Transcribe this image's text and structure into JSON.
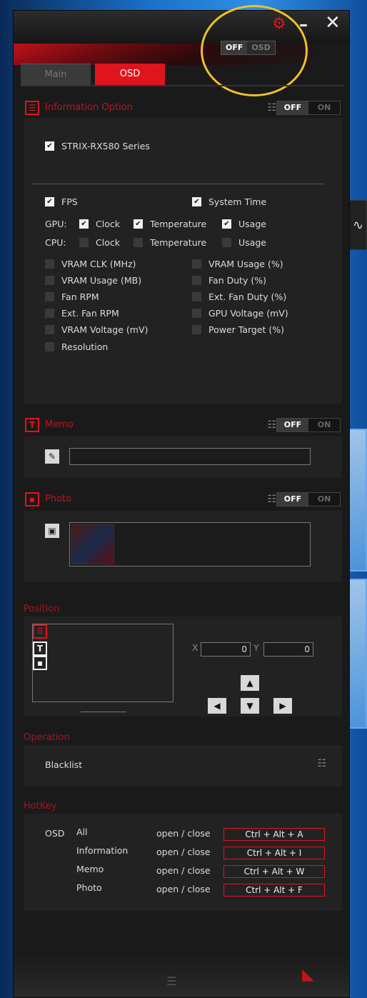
{
  "window": {
    "icons": {
      "gear": "gear-icon",
      "minimize": "minimize-icon",
      "close": "close-icon"
    },
    "minimize_glyph": "–",
    "close_glyph": "✕",
    "gear_glyph": "⚙"
  },
  "osd_master": {
    "on_label": "OFF",
    "off_label": "OSD"
  },
  "tabs": [
    {
      "label": "Main",
      "active": false
    },
    {
      "label": "OSD",
      "active": true
    }
  ],
  "information": {
    "title": "Information Option",
    "toggle": {
      "off": "OFF",
      "on": "ON",
      "state": "OFF"
    },
    "gpu_model": {
      "label": "STRIX-RX580 Series",
      "checked": true
    },
    "fps": {
      "label": "FPS",
      "checked": true
    },
    "system_time": {
      "label": "System Time",
      "checked": true
    },
    "gpu_row": {
      "label": "GPU:",
      "clock": "Clock",
      "temperature": "Temperature",
      "usage": "Usage"
    },
    "cpu_row": {
      "label": "CPU:",
      "clock": "Clock",
      "temperature": "Temperature",
      "usage": "Usage"
    },
    "left_items": [
      "VRAM CLK (MHz)",
      "VRAM Usage (MB)",
      "Fan RPM",
      "Ext. Fan RPM",
      "VRAM Voltage (mV)",
      "Resolution"
    ],
    "right_items": [
      "VRAM Usage (%)",
      "Fan Duty (%)",
      "Ext. Fan Duty (%)",
      "GPU Voltage (mV)",
      "Power Target (%)"
    ]
  },
  "memo": {
    "title": "Memo",
    "toggle": {
      "off": "OFF",
      "on": "ON",
      "state": "OFF"
    },
    "value": ""
  },
  "photo": {
    "title": "Photo",
    "toggle": {
      "off": "OFF",
      "on": "ON",
      "state": "OFF"
    }
  },
  "position": {
    "title": "Position",
    "x_label": "X",
    "y_label": "Y",
    "x_value": "0",
    "y_value": "0"
  },
  "operation": {
    "title": "Operation",
    "blacklist_label": "Blacklist"
  },
  "hotkey": {
    "title": "HotKey",
    "group_label": "OSD",
    "rows": [
      {
        "item": "All",
        "action": "open / close",
        "keys": "Ctrl + Alt + A"
      },
      {
        "item": "Information",
        "action": "open / close",
        "keys": "Ctrl + Alt + I"
      },
      {
        "item": "Memo",
        "action": "open / close",
        "keys": "Ctrl + Alt + W"
      },
      {
        "item": "Photo",
        "action": "open / close",
        "keys": "Ctrl + Alt + F"
      }
    ]
  },
  "colors": {
    "accent": "#e0141e",
    "panel": "#222222",
    "bg": "#1a1a1a",
    "highlight": "#f2c029"
  }
}
